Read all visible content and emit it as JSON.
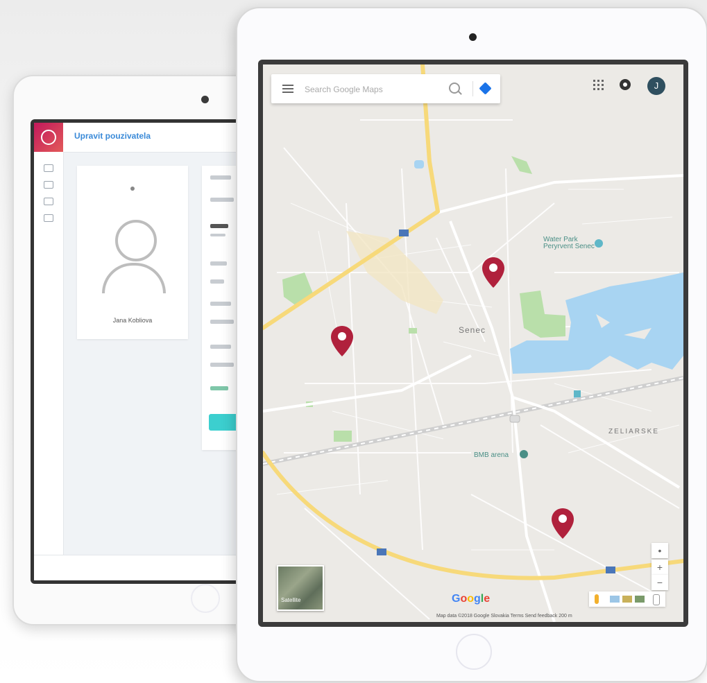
{
  "back_app": {
    "title": "Upravit pouzivatela",
    "profile_name": "Jana Kobliova"
  },
  "map": {
    "search_placeholder": "Search Google Maps",
    "account_initial": "J",
    "pois": {
      "water_park": "Water Park\nPeryrvent Senec",
      "bmb_arena": "BMB arena"
    },
    "town": "Senec",
    "district": "ZELIARSKE",
    "satellite_label": "Satellite",
    "zoom_in": "+",
    "zoom_out": "−",
    "google_letters": [
      "G",
      "o",
      "o",
      "g",
      "l",
      "e"
    ],
    "attribution": "Map data ©2018 Google   Slovakia   Terms   Send feedback   200 m",
    "colors": {
      "pin": "#b0213c",
      "water": "#a8d4f2",
      "park": "#b9dfaa",
      "major_road": "#f7d97a"
    }
  }
}
